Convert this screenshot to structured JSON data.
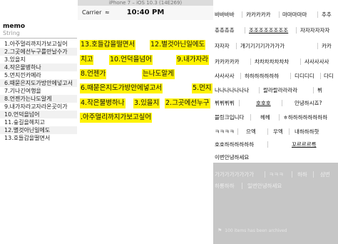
{
  "left": {
    "column_title": "memo",
    "column_type": "String",
    "rows": [
      "1.아주멀리까지가보고싶어",
      "2.그곳에선누구를만날수가",
      "3.있을지",
      "4.작은물병하나",
      "5.먼지낀카메라",
      "6.때묻은지도가방안에넣고서",
      "7.기나긴여행을",
      "8.언젠가는나도알게",
      "9.내가자라고자라온곳이가",
      "10.언덕을넘어",
      "11.숲길을헤치고",
      "12.별것아닌일에도",
      "13.호들갑을떨면서"
    ]
  },
  "phone": {
    "window_title": "iPhone 7 – iOS 10.3 (14E269)",
    "carrier": "Carrier",
    "wifi_glyph": "≈",
    "time": "10:40 PM",
    "highlights": [
      "13.호들갑을떨면서",
      "12.별것아닌일에도",
      "치고",
      "10.언덕을넘어",
      "9.내가자라",
      "8.언젠가",
      "는나도알게",
      "6.때묻은지도가방안에넣고서",
      "5.먼지",
      "4.작은물병하나",
      "3.있을지",
      "2.그곳에선누구",
      ".아주멀리까지가보고싶어"
    ]
  },
  "right": {
    "tags": [
      "바바바바",
      "카카카카카",
      "마마마마마",
      "추추",
      "츄츄츄츄",
      "조조조조조조조조",
      "자자자자자자",
      "자자자",
      "개기기기기가가가가",
      "카카",
      "카카카카카",
      "차차차차차차차",
      "사사사사사",
      "사사사사",
      "하하하하하하하",
      "디디디디",
      "다디",
      "나나나나나나나",
      "랄라랄라라라라",
      "뷔",
      "뷔뷔뷔뷔",
      "호호호",
      "안녕하시죠?",
      "블링크입니다",
      "헤헤",
      "ㅎ하하하하하하하하",
      "ㅋㅋㅋㅋ",
      "으엑",
      "우엑",
      "내하하하핫",
      "호호하하하하하하",
      "꼬르르르륵",
      "이번안녕하세요"
    ],
    "grey_tags": [
      "가가가가가가가가",
      "ㅋㅋㅋ",
      "하하",
      "삼번",
      "하룡하하",
      "일번안녕하세요"
    ],
    "archived_icon": "⚑",
    "archived_text": "100 items has been archived"
  },
  "colors": {
    "highlight": "#fff200",
    "grey_panel": "#c6c6c6"
  }
}
